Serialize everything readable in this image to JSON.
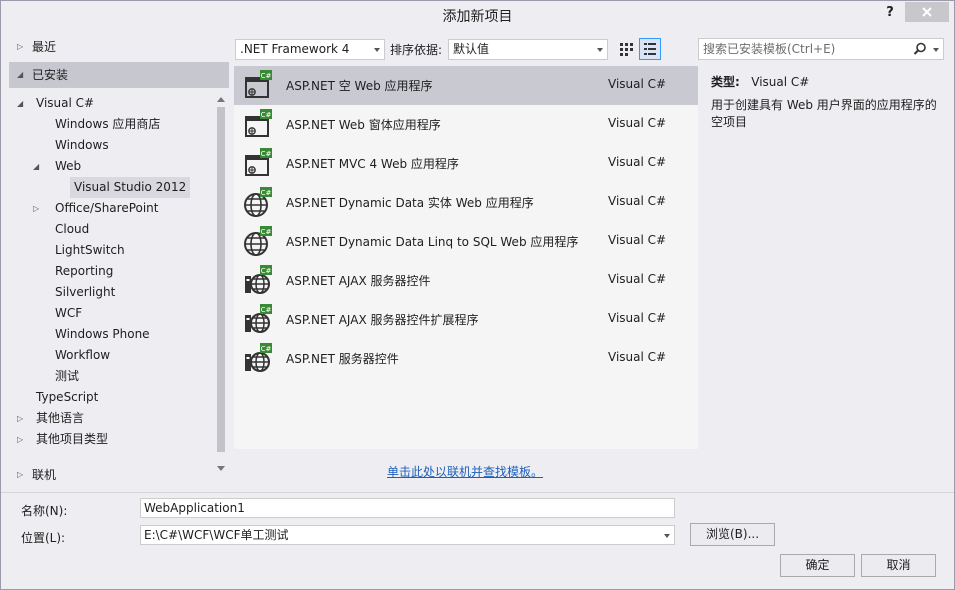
{
  "window": {
    "title": "添加新项目",
    "help_label": "?",
    "close_icon": "close-icon"
  },
  "nav": {
    "recent": "最近",
    "installed": "已安装",
    "online": "联机",
    "tree": [
      {
        "label": "Visual C#",
        "expander": "◢"
      },
      {
        "label": "Windows 应用商店",
        "expander": ""
      },
      {
        "label": "Windows",
        "expander": ""
      },
      {
        "label": "Web",
        "expander": "◢"
      },
      {
        "label": "Visual Studio 2012",
        "expander": ""
      },
      {
        "label": "Office/SharePoint",
        "expander": "▷"
      },
      {
        "label": "Cloud",
        "expander": ""
      },
      {
        "label": "LightSwitch",
        "expander": ""
      },
      {
        "label": "Reporting",
        "expander": ""
      },
      {
        "label": "Silverlight",
        "expander": ""
      },
      {
        "label": "WCF",
        "expander": ""
      },
      {
        "label": "Windows Phone",
        "expander": ""
      },
      {
        "label": "Workflow",
        "expander": ""
      },
      {
        "label": "测试",
        "expander": ""
      },
      {
        "label": "TypeScript",
        "expander": ""
      },
      {
        "label": "其他语言",
        "expander": "▷"
      },
      {
        "label": "其他项目类型",
        "expander": "▷"
      }
    ]
  },
  "toolbar": {
    "framework": ".NET Framework 4",
    "sort_label": "排序依据:",
    "sort_value": "默认值",
    "search_placeholder": "搜索已安装模板(Ctrl+E)"
  },
  "templates": [
    {
      "name": "ASP.NET 空 Web 应用程序",
      "lang": "Visual C#",
      "icon": "web-app-icon"
    },
    {
      "name": "ASP.NET Web 窗体应用程序",
      "lang": "Visual C#",
      "icon": "web-app-icon"
    },
    {
      "name": "ASP.NET MVC 4 Web 应用程序",
      "lang": "Visual C#",
      "icon": "web-app-icon"
    },
    {
      "name": "ASP.NET Dynamic Data 实体 Web 应用程序",
      "lang": "Visual C#",
      "icon": "globe-icon"
    },
    {
      "name": "ASP.NET Dynamic Data Linq to SQL Web 应用程序",
      "lang": "Visual C#",
      "icon": "globe-icon"
    },
    {
      "name": "ASP.NET AJAX 服务器控件",
      "lang": "Visual C#",
      "icon": "server-control-icon"
    },
    {
      "name": "ASP.NET AJAX 服务器控件扩展程序",
      "lang": "Visual C#",
      "icon": "server-control-icon"
    },
    {
      "name": "ASP.NET 服务器控件",
      "lang": "Visual C#",
      "icon": "server-control-icon"
    }
  ],
  "online_link": "单击此处以联机并查找模板。",
  "description": {
    "type_label": "类型:",
    "type_value": "Visual C#",
    "text": "用于创建具有 Web 用户界面的应用程序的空项目"
  },
  "form": {
    "name_label": "名称(N):",
    "name_value": "WebApplication1",
    "location_label": "位置(L):",
    "location_value": "E:\\C#\\WCF\\WCF单工测试",
    "browse": "浏览(B)...",
    "ok": "确定",
    "cancel": "取消"
  }
}
